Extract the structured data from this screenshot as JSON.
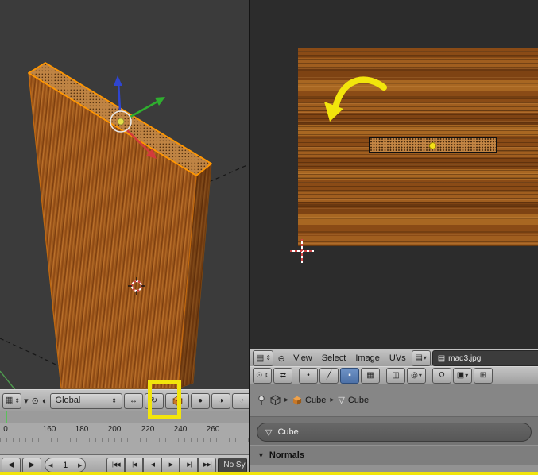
{
  "colors": {
    "annotation_yellow": "#f2e50c",
    "pressed_blue": "#5b80b7",
    "face_select_orange": "#ff9600",
    "viewport_bg": "#3b3b3b",
    "uv_bg": "#2c2c2c"
  },
  "icons": {
    "editor_3d": "▦",
    "editor_image": "▤",
    "editor_arrows": "⇕",
    "menu_collapse": "▾",
    "mode": "⊙",
    "shading": "◐",
    "manip_translate": "↔",
    "manip_rotate": "↻",
    "shade_sphere": "●",
    "shade_half": "◑",
    "header_right": "◔",
    "dropdown_arrows": "⇕",
    "stepper_left": "◀",
    "stepper_right": "▶",
    "collapse_round": "⊖",
    "browse_image": "▤",
    "photo": "▤",
    "pivot": "⊙",
    "uv_sync": "⇄",
    "select_vertex": "•",
    "select_edge": "╱",
    "select_face": "▪",
    "select_island": "▦",
    "sticky": "◫",
    "proportional": "◎",
    "snap_magnet": "Ω",
    "snap_element": "▣",
    "uv_more": "⊞",
    "breadcrumb_arrow": "▸",
    "mesh_data": "▽",
    "panel_open": "▼"
  },
  "view3d": {
    "orientation": "Global"
  },
  "timeline": {
    "ruler": [
      "0",
      "160",
      "180",
      "200",
      "220",
      "240",
      "260"
    ],
    "frame": "1",
    "playback": [
      "|◀◀",
      "|◀",
      "◀",
      "▶",
      "▶|",
      "▶▶|"
    ],
    "sync": "No Sync"
  },
  "uv": {
    "menus": [
      "View",
      "Select",
      "Image",
      "UVs"
    ],
    "image_name": "mad3.jpg"
  },
  "props": {
    "object_name": "Cube",
    "mesh_name": "Cube",
    "name_field": "Cube",
    "panel_title": "Normals"
  }
}
